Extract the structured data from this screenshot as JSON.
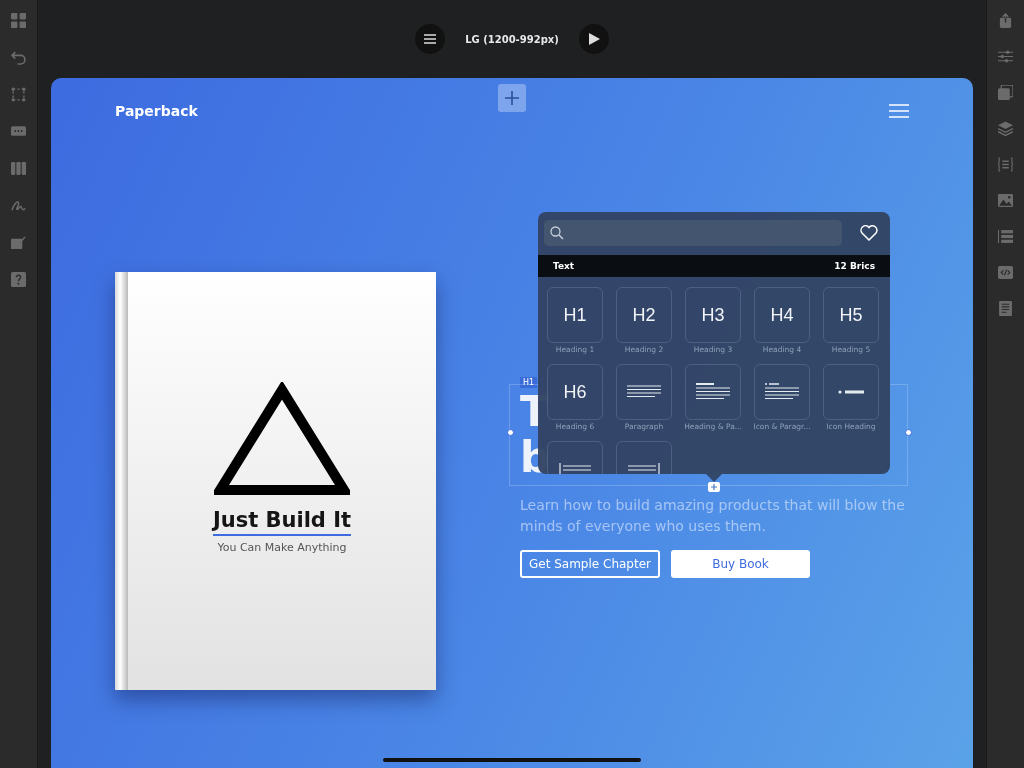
{
  "top_bar": {
    "breakpoint": "LG (1200-992px)"
  },
  "page": {
    "brand": "Paperback",
    "book": {
      "title": "Just Build It",
      "subtitle": "You Can Make Anything"
    },
    "hero": {
      "tag": "H1",
      "heading_visible": [
        "T",
        "b"
      ],
      "paragraph": "Learn how to build amazing products that will blow the minds of everyone who uses them.",
      "buttons": [
        {
          "label": "Get Sample Chapter",
          "kind": "outline"
        },
        {
          "label": "Buy Book",
          "kind": "solid"
        }
      ]
    }
  },
  "bric_picker": {
    "category": "Text",
    "count": "12 Brics",
    "tiles": [
      {
        "kind": "heading",
        "glyph": "H1",
        "label": "Heading 1"
      },
      {
        "kind": "heading",
        "glyph": "H2",
        "label": "Heading 2"
      },
      {
        "kind": "heading",
        "glyph": "H3",
        "label": "Heading 3"
      },
      {
        "kind": "heading",
        "glyph": "H4",
        "label": "Heading 4"
      },
      {
        "kind": "heading",
        "glyph": "H5",
        "label": "Heading 5"
      },
      {
        "kind": "heading",
        "glyph": "H6",
        "label": "Heading 6"
      },
      {
        "kind": "paragraph",
        "label": "Paragraph"
      },
      {
        "kind": "heading-paragraph",
        "label": "Heading & Pa..."
      },
      {
        "kind": "icon-paragraph",
        "label": "Icon & Paragr..."
      },
      {
        "kind": "icon-heading",
        "label": "Icon Heading"
      },
      {
        "kind": "left-bar"
      },
      {
        "kind": "right-bar"
      }
    ]
  }
}
